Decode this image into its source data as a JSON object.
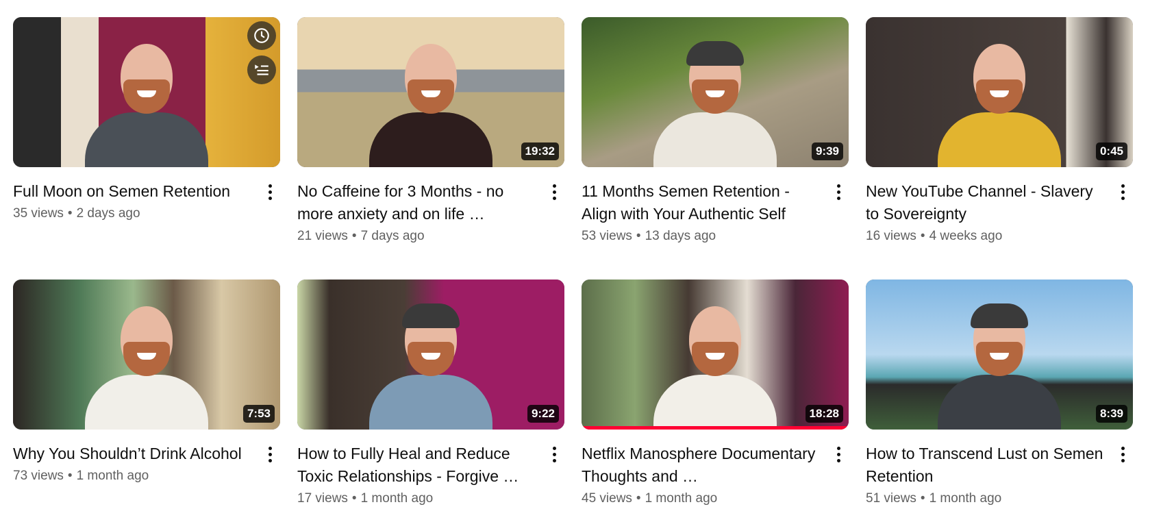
{
  "colors": {
    "accent_progress": "#ff0033",
    "title_text": "#0f0f0f",
    "meta_text": "#606060",
    "duration_bg": "#000000"
  },
  "hover_icons": [
    "watch-later-icon",
    "add-to-queue-icon"
  ],
  "videos": [
    {
      "title": "Full Moon on Semen Retention",
      "views": "35 views",
      "age": "2 days ago",
      "duration": "",
      "progress": 0,
      "scene": {
        "bg": "linear-gradient(90deg,#2a2a2a 0%,#2a2a2a 18%,#e9dfcf 18%,#e9dfcf 32%,#8a2246 32%,#8a2246 72%,#e5b23c 72%,#d49b2b 100%)",
        "shirt": "#4a5057",
        "cap": false
      }
    },
    {
      "title": "No Caffeine for 3 Months - no more anxiety and on life …",
      "views": "21 views",
      "age": "7 days ago",
      "duration": "19:32",
      "progress": 0,
      "scene": {
        "bg": "linear-gradient(180deg,#e8d5b0 0%,#e8d5b0 35%,#8e9499 35%,#8e9499 50%,#b9a97f 50%,#b9a97f 100%)",
        "shirt": "#2d1d1d",
        "cap": false
      }
    },
    {
      "title": "11 Months Semen Retention - Align with Your Authentic Self",
      "views": "53 views",
      "age": "13 days ago",
      "duration": "9:39",
      "progress": 0,
      "scene": {
        "bg": "linear-gradient(160deg,#3b5b2a 0%,#6a8a3c 35%,#a89c84 60%,#8d8270 100%)",
        "shirt": "#ebe7de",
        "cap": true
      }
    },
    {
      "title": "New YouTube Channel - Slavery to Sovereignty",
      "views": "16 views",
      "age": "4 weeks ago",
      "duration": "0:45",
      "progress": 0,
      "scene": {
        "bg": "linear-gradient(90deg,#3a3230 0%,#4a403c 75%,#e8e2d6 75%,#3a3230 90%,#d8d0c2 100%)",
        "shirt": "#e2b42f",
        "cap": false
      }
    },
    {
      "title": "Why You Shouldn’t Drink Alcohol",
      "views": "73 views",
      "age": "1 month ago",
      "duration": "7:53",
      "progress": 0,
      "scene": {
        "bg": "linear-gradient(90deg,#2c2623 0%,#4f7a57 25%,#9ab88c 45%,#6b5a48 60%,#d8c8a6 78%,#b09870 100%)",
        "shirt": "#f1efe9",
        "cap": false
      }
    },
    {
      "title": "How to Fully Heal and Reduce Toxic Relationships - Forgive …",
      "views": "17 views",
      "age": "1 month ago",
      "duration": "9:22",
      "progress": 0,
      "scene": {
        "bg": "linear-gradient(90deg,#c9d6a6 0%,#3a302a 12%,#4a3e36 40%,#9d1d64 55%,#9d1d64 100%)",
        "shirt": "#7d9bb5",
        "cap": true
      }
    },
    {
      "title": "Netflix Manosphere Documentary Thoughts and …",
      "views": "45 views",
      "age": "1 month ago",
      "duration": "18:28",
      "progress": 1,
      "scene": {
        "bg": "linear-gradient(90deg,#5c6e4a 0%,#8aa470 20%,#463a33 40%,#e4ddd2 62%,#4a2638 80%,#8f1d52 100%)",
        "shirt": "#f2efe8",
        "cap": false
      }
    },
    {
      "title": "How to Transcend Lust on Semen Retention",
      "views": "51 views",
      "age": "1 month ago",
      "duration": "8:39",
      "progress": 0,
      "scene": {
        "bg": "linear-gradient(180deg,#7fb6e3 0%,#b9d8ef 50%,#5ba7b3 65%,#2b2b2b 70%,#3f5f3a 100%)",
        "shirt": "#3b3f45",
        "cap": true
      }
    }
  ]
}
